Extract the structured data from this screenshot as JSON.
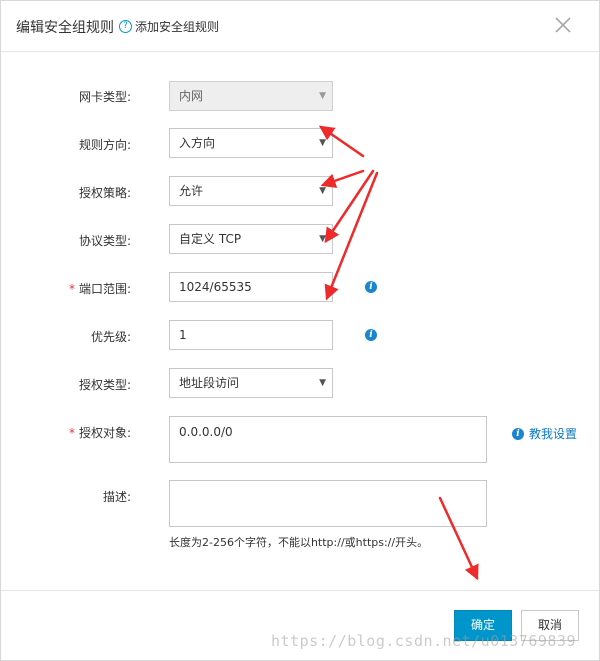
{
  "header": {
    "title": "编辑安全组规则",
    "help_icon": "question-icon",
    "help_link": "添加安全组规则",
    "close_icon": "close-icon"
  },
  "form": {
    "nic_type": {
      "label": "网卡类型:",
      "value": "内网",
      "disabled": true
    },
    "direction": {
      "label": "规则方向:",
      "value": "入方向"
    },
    "policy": {
      "label": "授权策略:",
      "value": "允许"
    },
    "protocol": {
      "label": "协议类型:",
      "value": "自定义 TCP"
    },
    "port_range": {
      "required_mark": "*",
      "label": "端口范围:",
      "value": "1024/65535",
      "info_icon": "info-icon"
    },
    "priority": {
      "label": "优先级:",
      "value": "1",
      "info_icon": "info-icon"
    },
    "auth_type": {
      "label": "授权类型:",
      "value": "地址段访问"
    },
    "auth_object": {
      "required_mark": "*",
      "label": "授权对象:",
      "value": "0.0.0.0/0",
      "help_link": "教我设置"
    },
    "description": {
      "label": "描述:",
      "value": "",
      "hint": "长度为2-256个字符，不能以http://或https://开头。"
    }
  },
  "footer": {
    "ok_label": "确定",
    "cancel_label": "取消"
  },
  "watermark": "https://blog.csdn.net/u013769839",
  "colors": {
    "primary_button": "#0096cc",
    "link": "#0b7ac4",
    "required": "#e33333",
    "annotation_arrow": "#ee2a2a"
  }
}
